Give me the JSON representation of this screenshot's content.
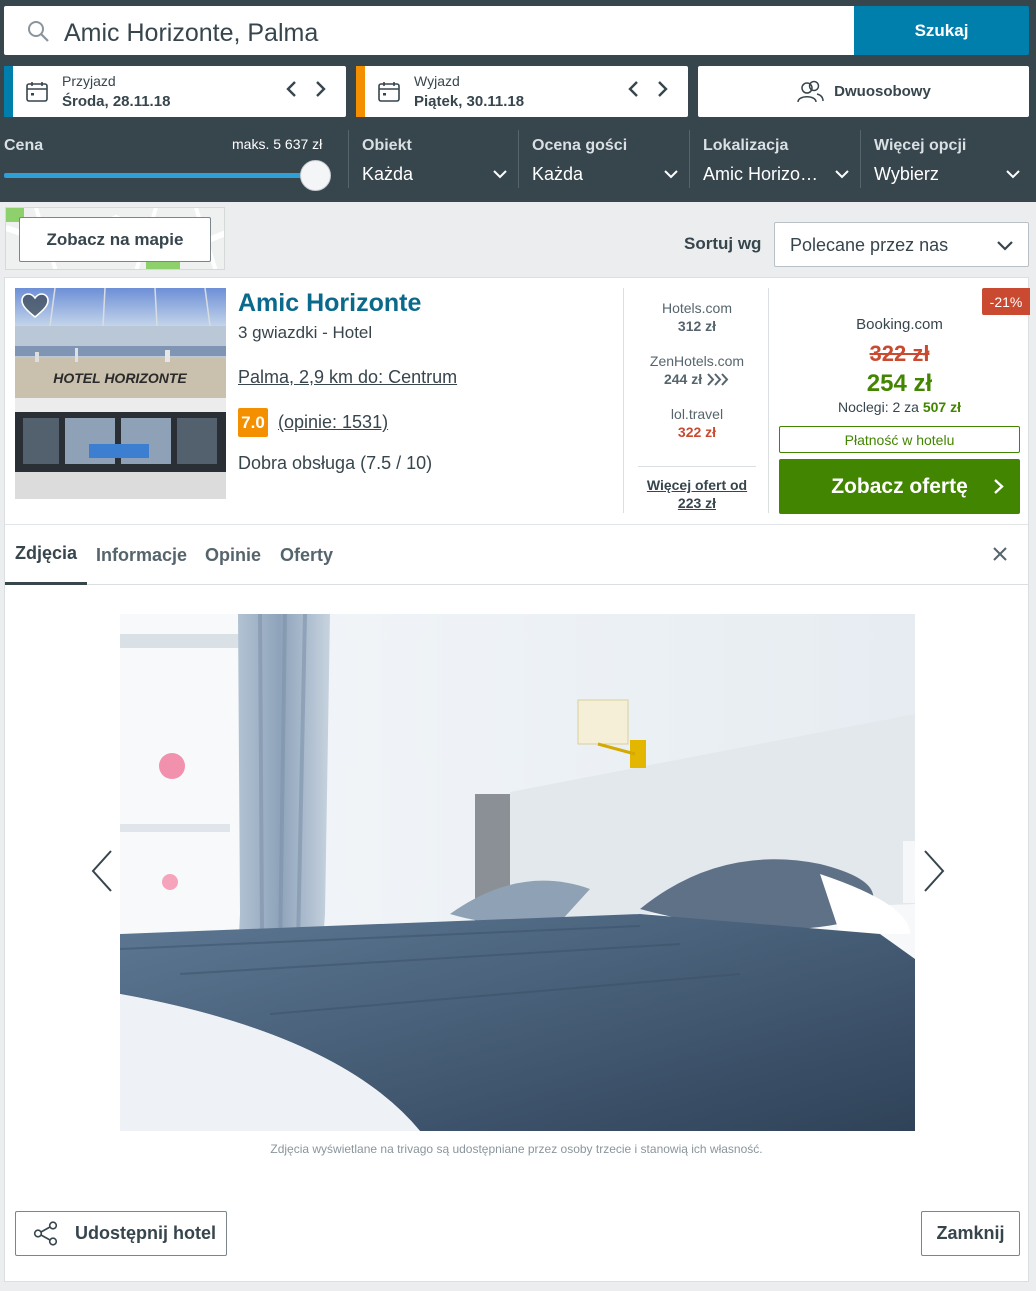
{
  "search": {
    "query": "Amic Horizonte, Palma",
    "button_label": "Szukaj"
  },
  "checkin": {
    "label": "Przyjazd",
    "value": "Środa, 28.11.18",
    "accent": "#007fad"
  },
  "checkout": {
    "label": "Wyjazd",
    "value": "Piątek, 30.11.18",
    "accent": "#f48f00"
  },
  "room": {
    "label": "Dwuosobowy",
    "icon": "people-icon"
  },
  "filters": {
    "price": {
      "label": "Cena",
      "max_label": "maks. 5 637 zł",
      "slider_fraction": 1.0
    },
    "items": [
      {
        "label": "Obiekt",
        "value": "Każda"
      },
      {
        "label": "Ocena gości",
        "value": "Każda"
      },
      {
        "label": "Lokalizacja",
        "value": "Amic Horizonte"
      },
      {
        "label": "Więcej opcji",
        "value": "Wybierz"
      }
    ]
  },
  "map": {
    "button_label": "Zobacz na mapie"
  },
  "sort": {
    "label": "Sortuj wg",
    "value": "Polecane przez nas"
  },
  "hotel": {
    "name": "Amic Horizonte",
    "type": "3 gwiazdki -  Hotel",
    "location": "Palma, 2,9 km do: Centrum",
    "rating": "7.0",
    "reviews": "(opinie: 1531)",
    "rating_text": "Dobra obsługa (7.5 / 10)",
    "thumb_sign": "HOTEL HORIZONTE"
  },
  "deals": [
    {
      "provider": "Hotels.com",
      "price": "312 zł",
      "highlight": false
    },
    {
      "provider": "ZenHotels.com",
      "price": "244 zł",
      "highlight": false
    },
    {
      "provider": "lol.travel",
      "price": "322 zł",
      "highlight": true
    }
  ],
  "more_deals": {
    "line1": "Więcej ofert od",
    "line2": "223 zł"
  },
  "best_offer": {
    "discount": "-21%",
    "provider": "Booking.com",
    "old_price": "322 zł",
    "new_price": "254 zł",
    "nights_text": "Noclegi: 2 za",
    "nights_total": "507 zł",
    "payment_badge": "Płatność w hotelu",
    "cta_label": "Zobacz ofertę",
    "colors": {
      "green": "#428500",
      "red": "#c94a30"
    }
  },
  "tabs": [
    {
      "label": "Zdjęcia",
      "active": true
    },
    {
      "label": "Informacje",
      "active": false
    },
    {
      "label": "Opinie",
      "active": false
    },
    {
      "label": "Oferty",
      "active": false
    }
  ],
  "gallery": {
    "caption": "Zdjęcia wyświetlane na trivago są udostępniane przez osoby trzecie i stanowią ich własność."
  },
  "footer": {
    "share_label": "Udostępnij hotel",
    "close_label": "Zamknij"
  }
}
